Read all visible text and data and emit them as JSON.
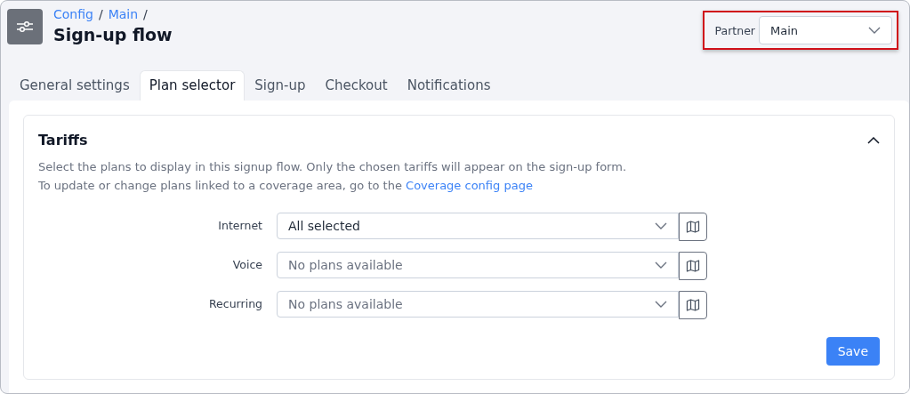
{
  "header": {
    "breadcrumbs": [
      {
        "label": "Config",
        "separator": "/"
      },
      {
        "label": "Main",
        "separator": "/"
      }
    ],
    "title": "Sign-up flow"
  },
  "partner": {
    "label": "Partner",
    "value": "Main",
    "highlighted": true
  },
  "tabs": [
    {
      "label": "General settings",
      "selected": false
    },
    {
      "label": "Plan selector",
      "selected": true
    },
    {
      "label": "Sign-up",
      "selected": false
    },
    {
      "label": "Checkout",
      "selected": false
    },
    {
      "label": "Notifications",
      "selected": false
    }
  ],
  "section": {
    "title": "Tariffs",
    "expanded": true,
    "description": "Select the plans to display in this signup flow. Only the chosen tariffs will appear on the sign-up form.",
    "note": "To update or change plans linked to a coverage area, go to the",
    "link": "Coverage config page"
  },
  "fields": [
    {
      "label": "Internet",
      "value": "All selected"
    },
    {
      "label": "Voice",
      "placeholder": "No plans available"
    },
    {
      "label": "Recurring",
      "placeholder": "No plans available"
    }
  ],
  "buttons": [
    "Save"
  ]
}
